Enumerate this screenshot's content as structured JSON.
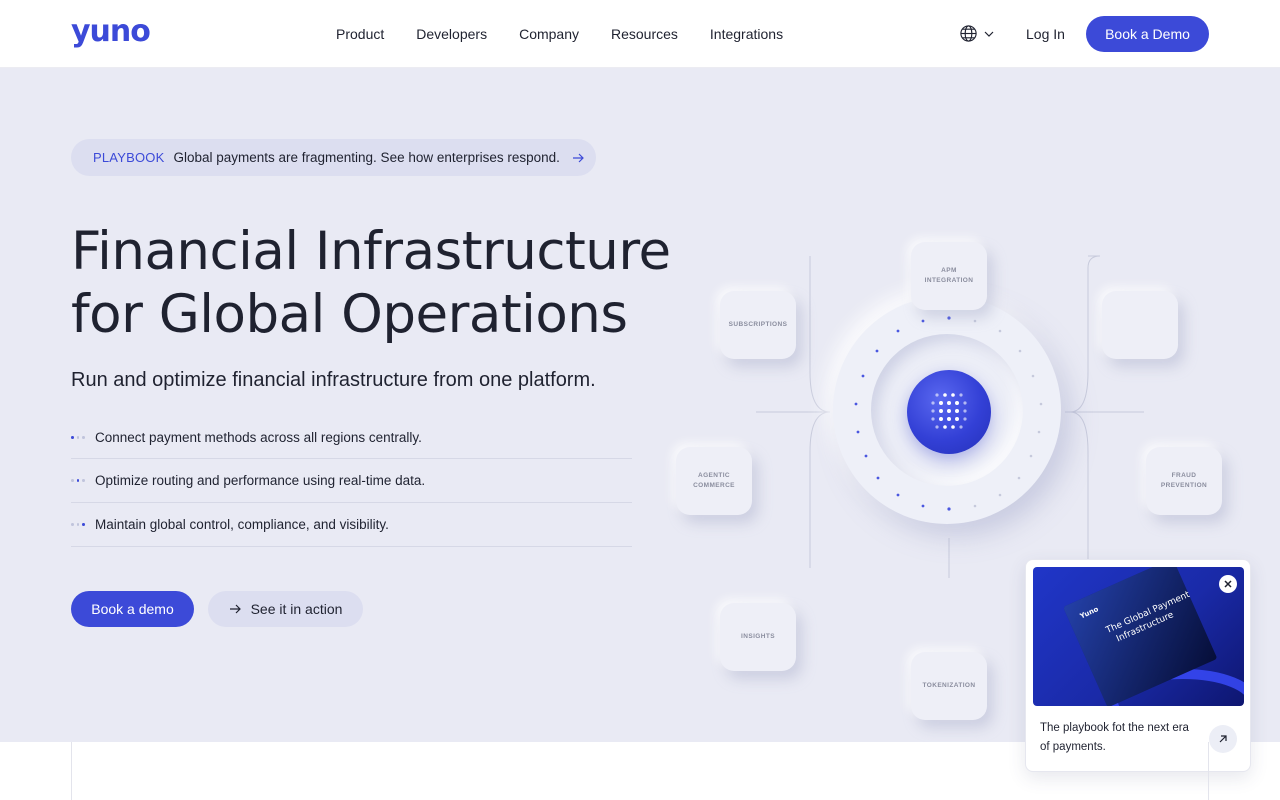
{
  "brand": {
    "logo_text": "yuno",
    "accent": "#3c4ad8"
  },
  "nav": {
    "items": [
      "Product",
      "Developers",
      "Company",
      "Resources",
      "Integrations"
    ],
    "language_icon": "globe-icon",
    "login": "Log In",
    "cta": "Book a Demo"
  },
  "hero": {
    "banner": {
      "tag": "PLAYBOOK",
      "text": "Global payments are fragmenting. See how enterprises respond."
    },
    "title_line1": "Financial Infrastructure",
    "title_line2": "for Global Operations",
    "subtitle": "Run and optimize financial infrastructure from one platform.",
    "features": [
      "Connect payment methods across all regions centrally.",
      "Optimize routing and performance using real-time data.",
      "Maintain global control, compliance, and visibility."
    ],
    "cta_primary": "Book a demo",
    "cta_secondary": "See it in action"
  },
  "diagram": {
    "nodes": {
      "apm_line1": "APM",
      "apm_line2": "INTEGRATION",
      "subscriptions": "SUBSCRIPTIONS",
      "agentic_line1": "AGENTIC",
      "agentic_line2": "COMMERCE",
      "fraud_line1": "FRAUD",
      "fraud_line2": "PREVENTION",
      "insights": "INSIGHTS",
      "tokenization": "TOKENIZATION"
    }
  },
  "popup": {
    "text": "The playbook fot the next era of payments.",
    "book_brand": "Yuno",
    "book_title_line1": "The Global Payment",
    "book_title_line2": "Infrastructure"
  }
}
